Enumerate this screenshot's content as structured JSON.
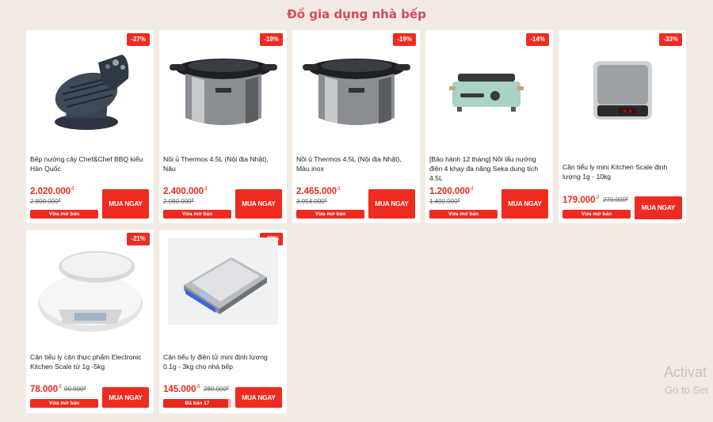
{
  "section_title": "Đồ gia dụng nhà bếp",
  "buy_label": "MUA NGAY",
  "products": [
    {
      "name": "Bếp nướng cây Chef&Chef BBQ kiểu Hàn Quốc",
      "price": "2.020.000",
      "old_price": "2.800.000",
      "discount": "-27%",
      "sold_label": "Vừa mở bán",
      "image": "grill-icon"
    },
    {
      "name": "Nồi ủ Thermos 4.5L (Nội địa Nhật), Nâu",
      "price": "2.400.000",
      "old_price": "2.080.000",
      "discount": "-19%",
      "sold_label": "Vừa mở bán",
      "image": "pot-icon"
    },
    {
      "name": "Nồi ủ Thermos 4.5L (Nội địa Nhật), Màu inox",
      "price": "2.465.000",
      "old_price": "3.054.000",
      "discount": "-19%",
      "sold_label": "Vừa mở bán",
      "image": "pot-icon"
    },
    {
      "name": "[Bảo hành 12 tháng] Nồi lẩu nướng điện 4 khay đa năng Seka dung tích 4.5L",
      "price": "1.200.000",
      "old_price": "1.400.000",
      "discount": "-14%",
      "sold_label": "Vừa mở bán",
      "image": "hotpot-icon"
    },
    {
      "name": "Cân tiểu ly mini Kitchen Scale định lượng 1g - 10kg",
      "price": "179.000",
      "old_price": "270.000",
      "discount": "-33%",
      "sold_label": "Vừa mở bán",
      "image": "scale-icon"
    },
    {
      "name": "Cân tiểu ly cân thực phẩm Electronic Kitchen Scale từ 1g -5kg",
      "price": "78.000",
      "old_price": "00.000",
      "discount": "-21%",
      "sold_label": "Vừa mở bán",
      "image": "kitchen-scale-icon"
    },
    {
      "name": "Cân tiểu ly điện tử mini định lượng 0.1g - 3kg cho nhà bếp",
      "price": "145.000",
      "old_price": "280.000",
      "discount": "-48%",
      "sold_label": "Đã bán 17",
      "sold_progress": 0.95,
      "image": "digital-scale-icon"
    }
  ],
  "currency": "đ",
  "watermark": {
    "line1": "Activat",
    "line2": "Go to Set"
  }
}
